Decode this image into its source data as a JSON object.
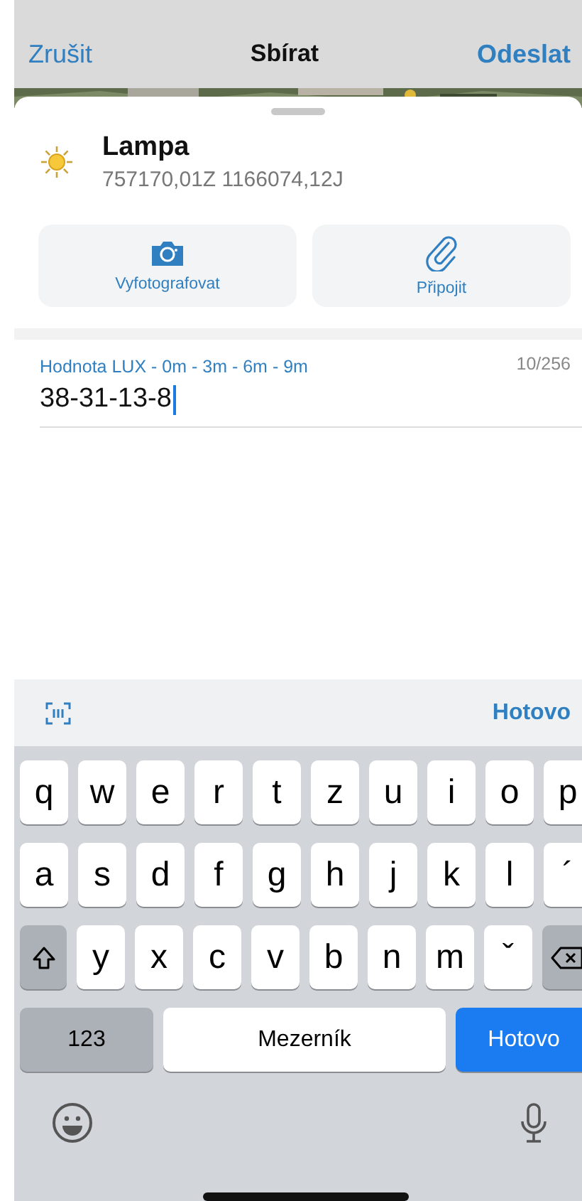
{
  "nav": {
    "cancel": "Zrušit",
    "title": "Sbírat",
    "send": "Odeslat"
  },
  "feature": {
    "name": "Lampa",
    "coordinates": "757170,01Z 1166074,12J"
  },
  "actions": [
    {
      "kind": "camera",
      "label": "Vyfotografovat"
    },
    {
      "kind": "attach",
      "label": "Připojit"
    }
  ],
  "field": {
    "label": "Hodnota LUX - 0m - 3m - 6m - 9m",
    "value": "38-31-13-8",
    "counter": "10/256",
    "focused": true
  },
  "accessory": {
    "done": "Hotovo"
  },
  "keyboard": {
    "rows": [
      [
        {
          "kind": "letter",
          "label": "q"
        },
        {
          "kind": "letter",
          "label": "w"
        },
        {
          "kind": "letter",
          "label": "e"
        },
        {
          "kind": "letter",
          "label": "r"
        },
        {
          "kind": "letter",
          "label": "t"
        },
        {
          "kind": "letter",
          "label": "z"
        },
        {
          "kind": "letter",
          "label": "u"
        },
        {
          "kind": "letter",
          "label": "i"
        },
        {
          "kind": "letter",
          "label": "o"
        },
        {
          "kind": "letter",
          "label": "p"
        }
      ],
      [
        {
          "kind": "letter",
          "label": "a"
        },
        {
          "kind": "letter",
          "label": "s"
        },
        {
          "kind": "letter",
          "label": "d"
        },
        {
          "kind": "letter",
          "label": "f"
        },
        {
          "kind": "letter",
          "label": "g"
        },
        {
          "kind": "letter",
          "label": "h"
        },
        {
          "kind": "letter",
          "label": "j"
        },
        {
          "kind": "letter",
          "label": "k"
        },
        {
          "kind": "letter",
          "label": "l"
        },
        {
          "kind": "letter",
          "label": "´"
        }
      ],
      [
        {
          "kind": "shift"
        },
        {
          "kind": "letter",
          "label": "y"
        },
        {
          "kind": "letter",
          "label": "x"
        },
        {
          "kind": "letter",
          "label": "c"
        },
        {
          "kind": "letter",
          "label": "v"
        },
        {
          "kind": "letter",
          "label": "b"
        },
        {
          "kind": "letter",
          "label": "n"
        },
        {
          "kind": "letter",
          "label": "m"
        },
        {
          "kind": "letter",
          "label": "ˇ"
        },
        {
          "kind": "backspace"
        }
      ]
    ],
    "bottom": [
      {
        "kind": "mode",
        "label": "123"
      },
      {
        "kind": "space",
        "label": "Mezerník"
      },
      {
        "kind": "return",
        "label": "Hotovo"
      }
    ]
  }
}
